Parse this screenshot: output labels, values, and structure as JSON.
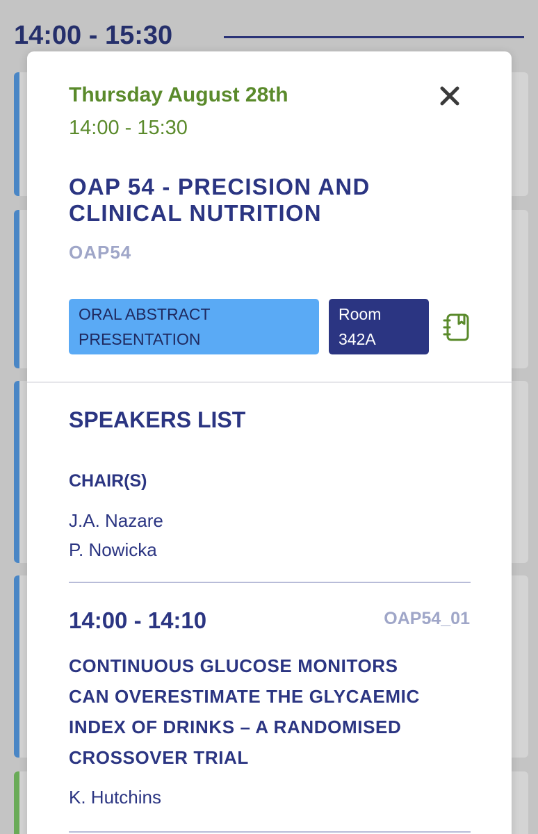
{
  "background": {
    "time_header": "14:00 - 15:30",
    "bar_colors": [
      "#4a86c5",
      "#4a86c5",
      "#4a86c5",
      "#4a86c5",
      "#6aab58"
    ]
  },
  "session": {
    "day": "Thursday August 28th",
    "time": "14:00 - 15:30",
    "title_line1": "OAP 54 - PRECISION AND",
    "title_line2": "CLINICAL NUTRITION",
    "code": "OAP54",
    "type_line1": "ORAL ABSTRACT",
    "type_line2": "PRESENTATION",
    "room_line1": "Room",
    "room_line2": "342A",
    "close_icon": "close-icon",
    "notebook_icon": "notebook-icon"
  },
  "speakers": {
    "heading": "SPEAKERS LIST",
    "chairs_heading": "CHAIR(S)",
    "chairs": [
      "J.A. Nazare",
      "P. Nowicka"
    ]
  },
  "talks": [
    {
      "time": "14:00 - 14:10",
      "code": "OAP54_01",
      "title_lines": [
        "CONTINUOUS GLUCOSE MONITORS",
        "CAN OVERESTIMATE THE GLYCAEMIC",
        "INDEX OF DRINKS – A RANDOMISED",
        "CROSSOVER TRIAL"
      ],
      "speaker": "K. Hutchins"
    }
  ],
  "colors": {
    "accent_green": "#5a8a2b",
    "navy": "#2b3582",
    "type_badge": "#5aaaf5",
    "muted": "#9fa6c8"
  }
}
